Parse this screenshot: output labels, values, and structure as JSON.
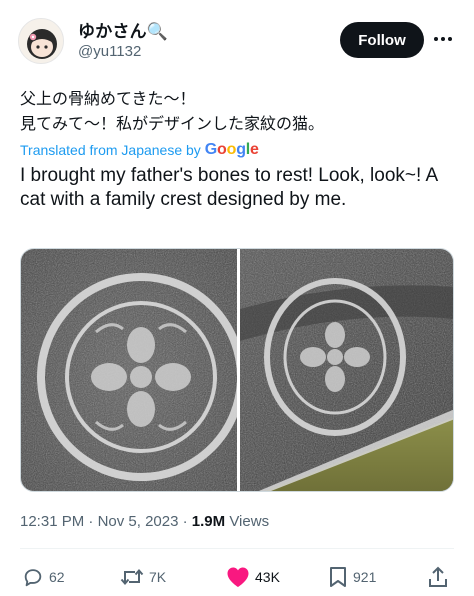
{
  "author": {
    "display_name": "ゆかさん🔍",
    "handle": "@yu1132"
  },
  "follow_label": "Follow",
  "more_icon": "more-horizontal-icon",
  "post": {
    "original_line1": "父上の骨納めてきた〜！",
    "original_line2": "見てみて〜！私がデザインした家紋の猫。",
    "translated_prefix": "Translated from Japanese by",
    "translated_brand": "Google",
    "translated_text": "I brought my father's bones to rest! Look, look~! A cat with a family crest designed by me."
  },
  "meta": {
    "time": "12:31 PM",
    "date": "Nov 5, 2023",
    "views_count": "1.9M",
    "views_label": "Views"
  },
  "actions": {
    "replies": "62",
    "reposts": "7K",
    "likes": "43K",
    "bookmarks": "921"
  },
  "colors": {
    "accent": "#1d9bf0",
    "like": "#f91880",
    "text": "#0f1419",
    "muted": "#536471"
  }
}
